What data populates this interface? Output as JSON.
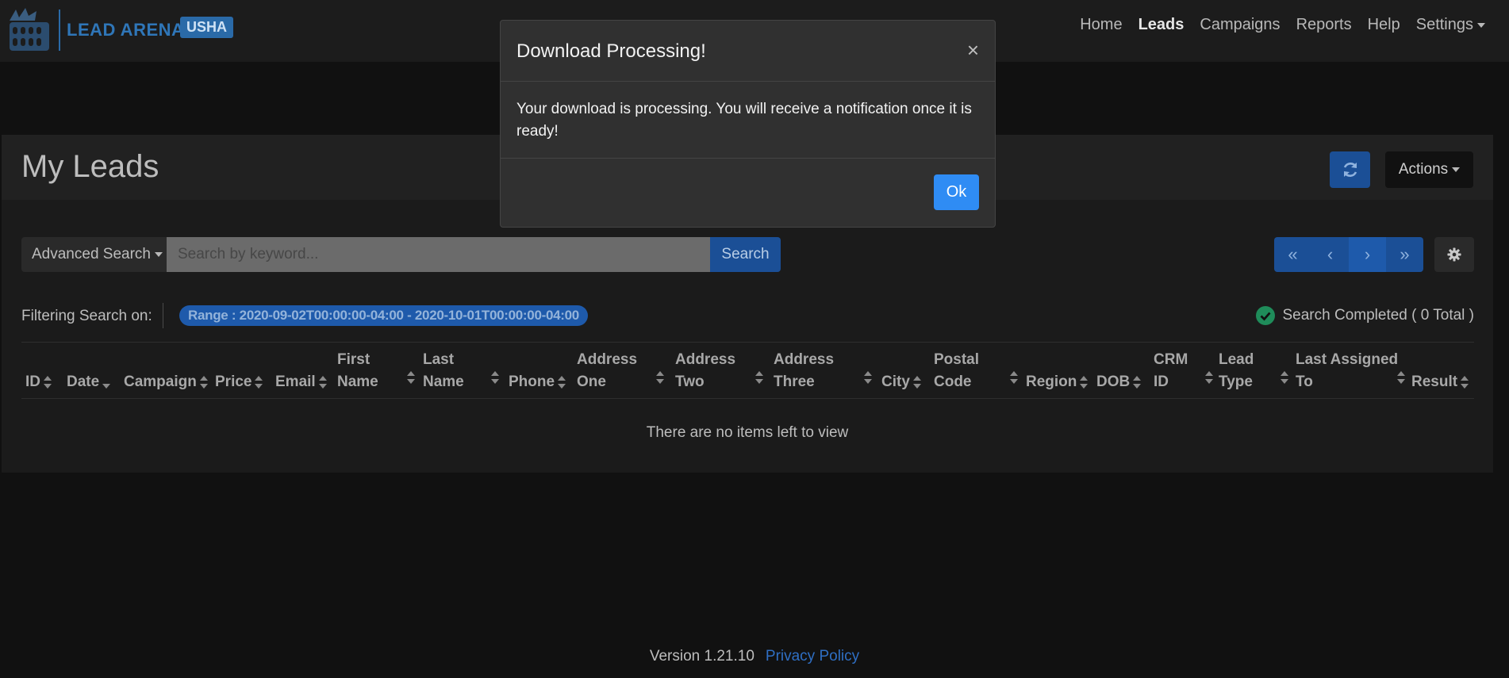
{
  "navbar": {
    "brand_name": "LEAD ARENA",
    "brand_badge": "USHA",
    "links": [
      "Home",
      "Leads",
      "Campaigns",
      "Reports",
      "Help",
      "Settings"
    ],
    "active_link": "Leads",
    "accent_color": "#2f76b8"
  },
  "card": {
    "title": "My Leads",
    "actions_label": "Actions",
    "refresh_icon": "refresh-icon"
  },
  "search": {
    "advanced_label": "Advanced Search",
    "placeholder": "Search by keyword...",
    "button_label": "Search"
  },
  "pager": {
    "first": "«",
    "prev": "‹",
    "next": "›",
    "last": "»"
  },
  "filter": {
    "label": "Filtering Search on:",
    "chip": "Range : 2020-09-02T00:00:00-04:00 - 2020-10-01T00:00:00-04:00",
    "status": "Search Completed ( 0 Total )"
  },
  "table": {
    "columns": [
      "ID",
      "Date",
      "Campaign",
      "Price",
      "Email",
      "First\nName",
      "Last\nName",
      "Phone",
      "Address\nOne",
      "Address\nTwo",
      "Address\nThree",
      "City",
      "Postal\nCode",
      "Region",
      "DOB",
      "CRM\nID",
      "Lead\nType",
      "Last Assigned\nTo",
      "Result"
    ],
    "empty_message": "There are no items left to view"
  },
  "footer": {
    "version": "Version 1.21.10",
    "privacy_link": "Privacy Policy"
  },
  "modal": {
    "title": "Download Processing!",
    "close": "×",
    "body": "Your download is processing. You will receive a notification once it is ready!",
    "ok_label": "Ok"
  }
}
